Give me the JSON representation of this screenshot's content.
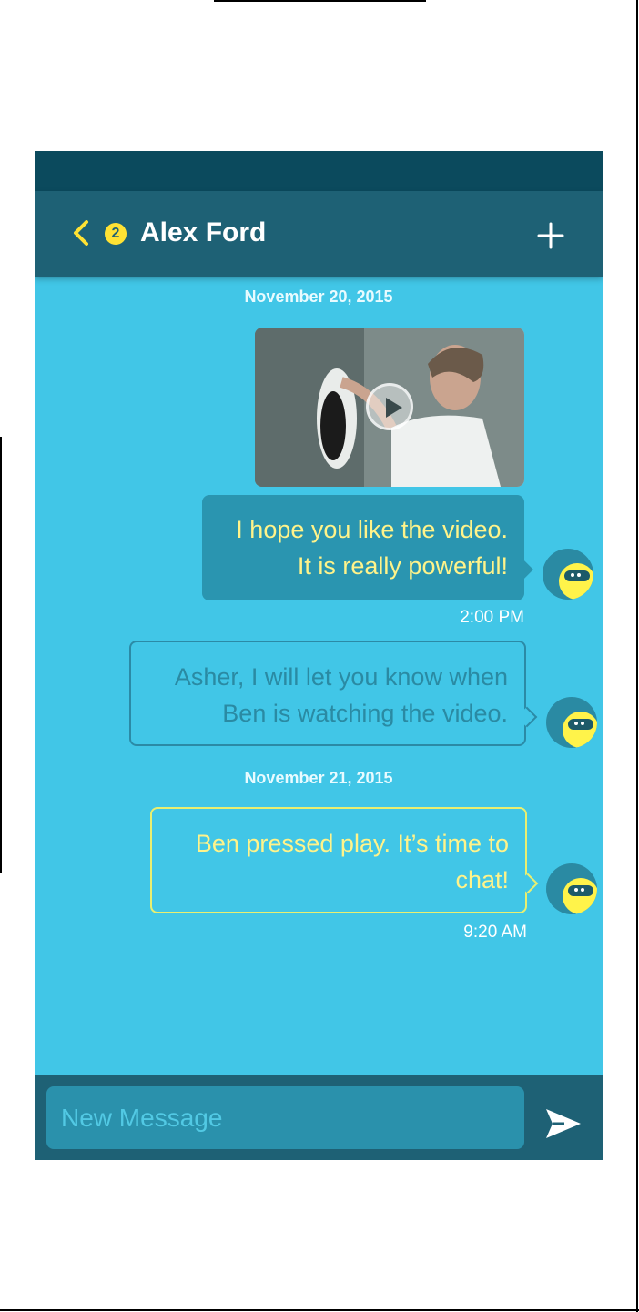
{
  "header": {
    "unread_count": "2",
    "contact_name": "Alex Ford"
  },
  "conversation": {
    "date_1": "November 20, 2015",
    "date_2": "November 21, 2015",
    "messages": [
      {
        "text_line1": "I hope you like the video.",
        "text_line2": "It is really powerful!",
        "time": "2:00 PM"
      },
      {
        "text_line1": "Asher, I will let you know when",
        "text_line2": "Ben is watching the video."
      },
      {
        "text_line1": "Ben pressed play. It’s time to",
        "text_line2": "chat!",
        "time": "9:20 AM"
      }
    ]
  },
  "composer": {
    "placeholder": "New Message"
  },
  "icons": {
    "back": "chevron-left-icon",
    "add": "plus-icon",
    "send": "send-icon",
    "play": "play-icon"
  },
  "colors": {
    "background": "#41c6e7",
    "header": "#1e6175",
    "accent": "#ffe234",
    "message_text": "#fff38a"
  }
}
